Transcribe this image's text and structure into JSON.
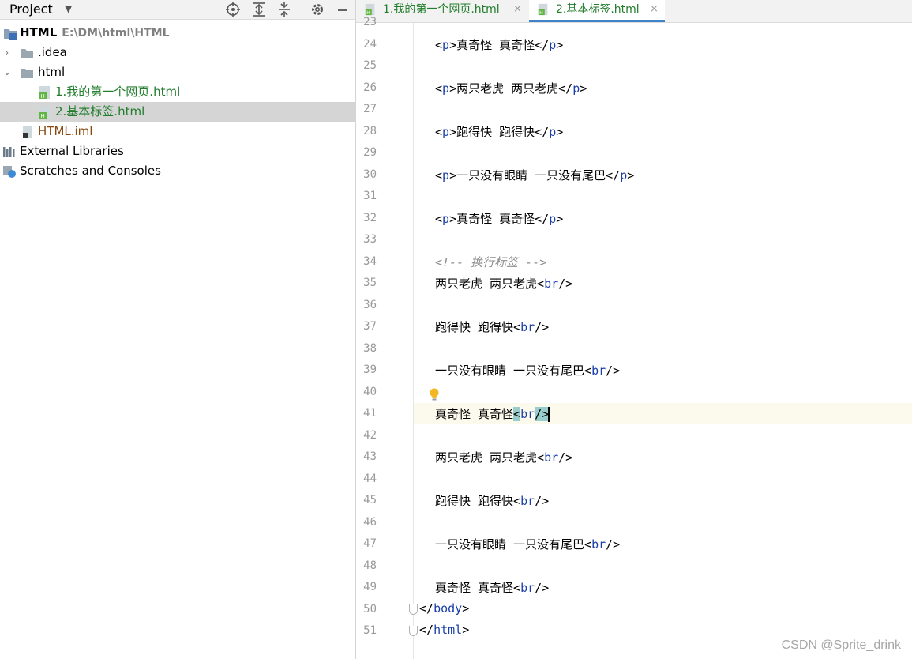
{
  "project_panel": {
    "title": "Project",
    "dropdown_icon": "chevron-down-icon",
    "toolbar_icons": [
      "crosshair-icon",
      "expand-all-icon",
      "collapse-all-icon",
      "gear-icon",
      "minimize-icon"
    ],
    "tree": [
      {
        "label": "HTML",
        "path": "E:\\DM\\html\\HTML",
        "icon": "module-folder-icon",
        "depth": 0,
        "arrow": "",
        "bold": true,
        "color": "#000000"
      },
      {
        "label": ".idea",
        "icon": "folder-icon",
        "depth": 1,
        "arrow": "›",
        "color": "#000000"
      },
      {
        "label": "html",
        "icon": "folder-icon",
        "depth": 1,
        "arrow": "⌄",
        "color": "#000000"
      },
      {
        "label": "1.我的第一个网页.html",
        "icon": "html-file-icon",
        "depth": 2,
        "color": "#227d2d"
      },
      {
        "label": "2.基本标签.html",
        "icon": "html-file-icon",
        "depth": 2,
        "color": "#227d2d",
        "selected": true
      },
      {
        "label": "HTML.iml",
        "icon": "iml-file-icon",
        "depth": 1,
        "color": "#8a4a10"
      },
      {
        "label": "External Libraries",
        "icon": "libraries-icon",
        "depth": 0,
        "color": "#000000"
      },
      {
        "label": "Scratches and Consoles",
        "icon": "scratches-icon",
        "depth": 0,
        "color": "#000000"
      }
    ]
  },
  "tabs": [
    {
      "label": "1.我的第一个网页.html",
      "close": "×",
      "active": false
    },
    {
      "label": "2.基本标签.html",
      "close": "×",
      "active": true
    }
  ],
  "editor": {
    "current_line": "41",
    "lines": [
      {
        "n": "23",
        "text": ""
      },
      {
        "n": "24",
        "text": "<p>真奇怪 真奇怪</p>"
      },
      {
        "n": "25",
        "text": ""
      },
      {
        "n": "26",
        "text": "<p>两只老虎 两只老虎</p>"
      },
      {
        "n": "27",
        "text": ""
      },
      {
        "n": "28",
        "text": "<p>跑得快 跑得快</p>"
      },
      {
        "n": "29",
        "text": ""
      },
      {
        "n": "30",
        "text": "<p>一只没有眼睛 一只没有尾巴</p>"
      },
      {
        "n": "31",
        "text": ""
      },
      {
        "n": "32",
        "text": "<p>真奇怪 真奇怪</p>"
      },
      {
        "n": "33",
        "text": ""
      },
      {
        "n": "34",
        "text": "<!-- 换行标签 -->"
      },
      {
        "n": "35",
        "text": "两只老虎 两只老虎<br/>"
      },
      {
        "n": "36",
        "text": ""
      },
      {
        "n": "37",
        "text": "跑得快 跑得快<br/>"
      },
      {
        "n": "38",
        "text": ""
      },
      {
        "n": "39",
        "text": "一只没有眼睛 一只没有尾巴<br/>"
      },
      {
        "n": "40",
        "text": ""
      },
      {
        "n": "41",
        "text": "真奇怪 真奇怪<br/>"
      },
      {
        "n": "42",
        "text": ""
      },
      {
        "n": "43",
        "text": "两只老虎 两只老虎<br/>"
      },
      {
        "n": "44",
        "text": ""
      },
      {
        "n": "45",
        "text": "跑得快 跑得快<br/>"
      },
      {
        "n": "46",
        "text": ""
      },
      {
        "n": "47",
        "text": "一只没有眼睛 一只没有尾巴<br/>"
      },
      {
        "n": "48",
        "text": ""
      },
      {
        "n": "49",
        "text": "真奇怪 真奇怪<br/>"
      },
      {
        "n": "50",
        "text": "</body>"
      },
      {
        "n": "51",
        "text": "</html>"
      }
    ],
    "intention_icon": "lightbulb-icon"
  },
  "colors": {
    "tag": "#1a3fa8",
    "comment": "#8c8c8c",
    "file_green": "#227d2d",
    "iml_brown": "#8a4a10",
    "tab_underline": "#4083c9"
  },
  "watermark": "CSDN @Sprite_drink"
}
